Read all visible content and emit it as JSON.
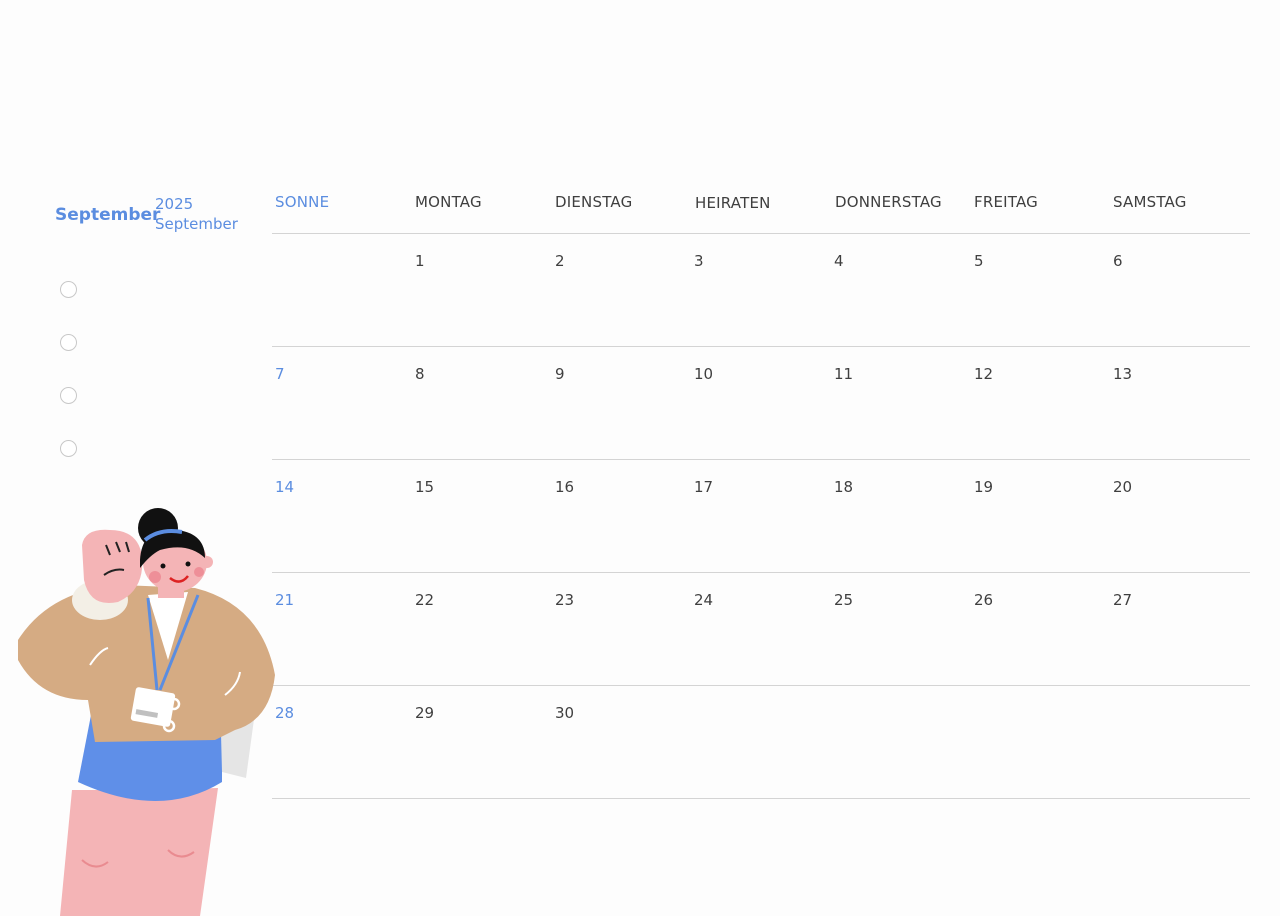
{
  "sidebar": {
    "month_label": "September",
    "year": "2025",
    "month_sub": "September",
    "checkboxes": 4
  },
  "calendar": {
    "day_names": [
      "SONNE",
      "MONTAG",
      "DIENSTAG",
      "HEIRATEN",
      "DONNERSTAG",
      "FREITAG",
      "SAMSTAG"
    ],
    "weeks": [
      [
        "",
        "1",
        "2",
        "3",
        "4",
        "5",
        "6"
      ],
      [
        "7",
        "8",
        "9",
        "10",
        "11",
        "12",
        "13"
      ],
      [
        "14",
        "15",
        "16",
        "17",
        "18",
        "19",
        "20"
      ],
      [
        "21",
        "22",
        "23",
        "24",
        "25",
        "26",
        "27"
      ],
      [
        "28",
        "29",
        "30",
        "",
        "",
        "",
        ""
      ]
    ]
  },
  "colors": {
    "accent": "#5b8de0",
    "text": "#3f3f3f",
    "line": "#d4d4d4"
  },
  "illustration": {
    "icon": "woman-with-badge-illustration"
  }
}
